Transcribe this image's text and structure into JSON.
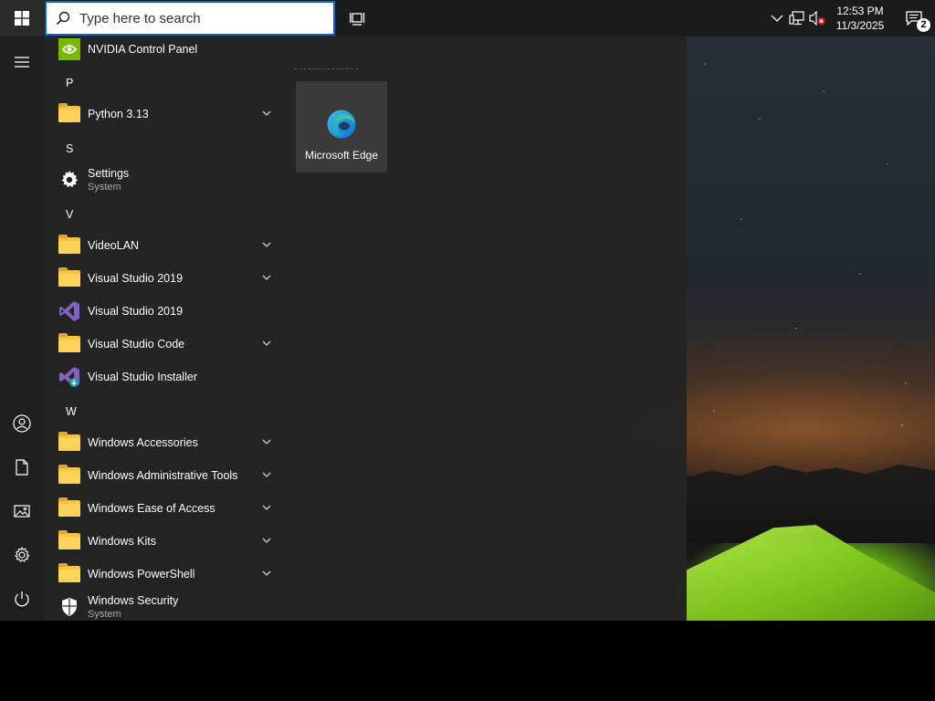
{
  "taskbar": {
    "search": {
      "placeholder": "Type here to search",
      "value": ""
    },
    "clock": {
      "time": "12:53 PM",
      "date": "11/3/2025"
    },
    "notifications": {
      "count": "2"
    },
    "tray_icons": [
      "chevron-up-icon",
      "network-icon",
      "volume-muted-icon"
    ]
  },
  "start_menu": {
    "rail": [
      "hamburger-icon",
      "user-icon",
      "documents-icon",
      "pictures-icon",
      "settings-icon",
      "power-icon"
    ],
    "apps": [
      {
        "type": "app",
        "name": "NVIDIA Control Panel",
        "icon": "nvidia-icon"
      },
      {
        "type": "letter",
        "name": "P"
      },
      {
        "type": "folder",
        "name": "Python 3.13",
        "expandable": true
      },
      {
        "type": "letter",
        "name": "S"
      },
      {
        "type": "app",
        "name": "Settings",
        "sub": "System",
        "icon": "gear-icon"
      },
      {
        "type": "letter",
        "name": "V"
      },
      {
        "type": "folder",
        "name": "VideoLAN",
        "expandable": true
      },
      {
        "type": "folder",
        "name": "Visual Studio 2019",
        "expandable": true
      },
      {
        "type": "app",
        "name": "Visual Studio 2019",
        "icon": "visual-studio-icon"
      },
      {
        "type": "folder",
        "name": "Visual Studio Code",
        "expandable": true
      },
      {
        "type": "app",
        "name": "Visual Studio Installer",
        "icon": "visual-studio-installer-icon"
      },
      {
        "type": "letter",
        "name": "W"
      },
      {
        "type": "folder",
        "name": "Windows Accessories",
        "expandable": true
      },
      {
        "type": "folder",
        "name": "Windows Administrative Tools",
        "expandable": true
      },
      {
        "type": "folder",
        "name": "Windows Ease of Access",
        "expandable": true
      },
      {
        "type": "folder",
        "name": "Windows Kits",
        "expandable": true
      },
      {
        "type": "folder",
        "name": "Windows PowerShell",
        "expandable": true
      },
      {
        "type": "app",
        "name": "Windows Security",
        "sub": "System",
        "icon": "shield-icon"
      }
    ],
    "tiles": [
      {
        "label": "Microsoft Edge",
        "icon": "edge-icon"
      }
    ]
  },
  "colors": {
    "accent": "#0a66c8",
    "menu_bg": "#242424",
    "folder": "#f6c443"
  }
}
